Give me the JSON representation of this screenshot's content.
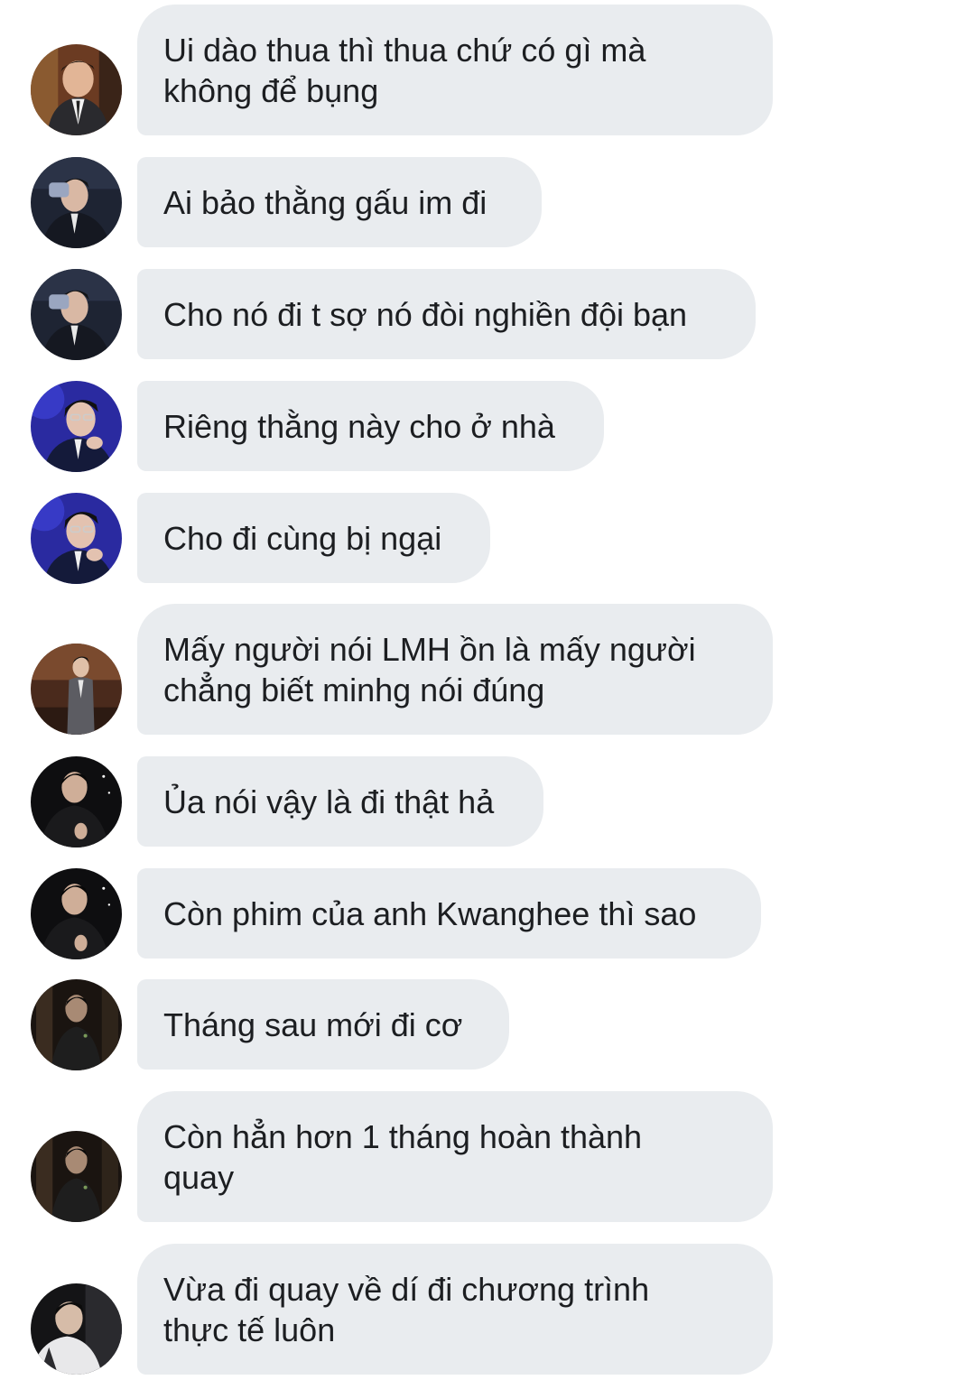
{
  "messages": [
    {
      "avatar": "user-photo-avatar",
      "text": "Ui dào thua thì thua chứ có gì mà\nkhông để bụng"
    },
    {
      "avatar": "user-photo-avatar",
      "text": "Ai bảo thằng gấu im đi"
    },
    {
      "avatar": "user-photo-avatar",
      "text": "Cho nó đi t sợ nó đòi nghiền đội bạn"
    },
    {
      "avatar": "user-photo-avatar",
      "text": "Riêng thằng này cho ở nhà"
    },
    {
      "avatar": "user-photo-avatar",
      "text": "Cho đi cùng bị ngại"
    },
    {
      "avatar": "user-photo-avatar",
      "text": "Mấy người nói LMH ồn là mấy người\nchẳng biết minhg nói đúng"
    },
    {
      "avatar": "user-photo-avatar",
      "text": "Ủa nói vậy là đi thật hả"
    },
    {
      "avatar": "user-photo-avatar",
      "text": "Còn phim của anh Kwanghee thì sao"
    },
    {
      "avatar": "user-photo-avatar",
      "text": "Tháng sau mới đi cơ"
    },
    {
      "avatar": "user-photo-avatar",
      "text": "Còn hẳn hơn 1 tháng hoàn thành\nquay"
    },
    {
      "avatar": "user-photo-avatar",
      "text": "Vừa đi quay về dí đi chương trình\nthực tế luôn"
    }
  ],
  "colors": {
    "bubble_bg": "#e9ecef",
    "text": "#1c1e21",
    "background": "#ffffff"
  }
}
